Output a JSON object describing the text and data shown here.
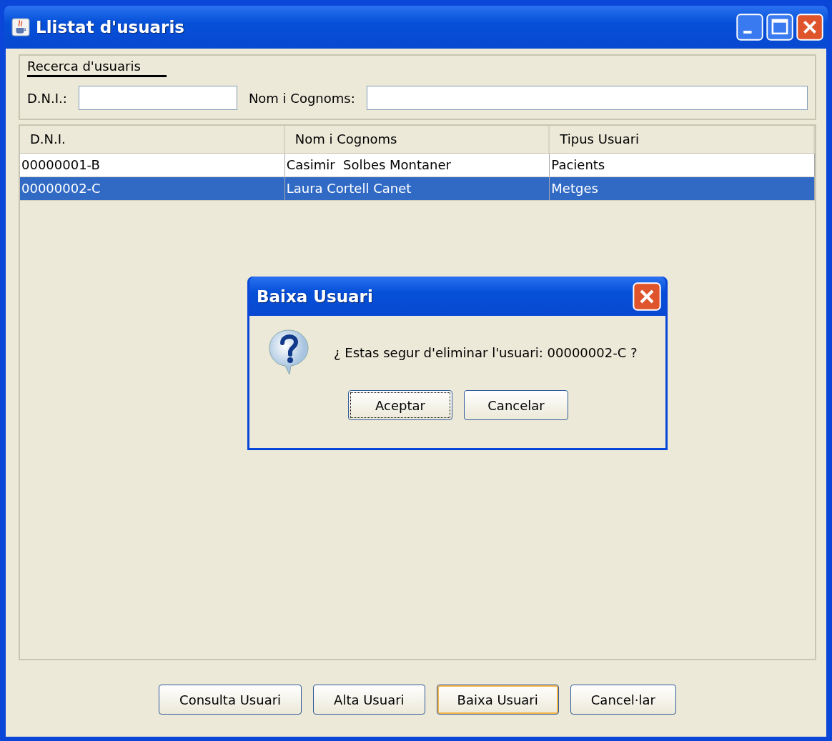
{
  "window": {
    "title": "Llistat d'usuaris"
  },
  "search": {
    "title": "Recerca d'usuaris",
    "fields": [
      {
        "label": "D.N.I.:"
      },
      {
        "label": "Nom i Cognoms:"
      }
    ]
  },
  "table": {
    "columns": [
      "D.N.I.",
      "Nom i Cognoms",
      "Tipus Usuari"
    ],
    "rows": [
      {
        "cells": [
          "00000001-B",
          "Casimir  Solbes Montaner",
          "Pacients"
        ],
        "selected": false
      },
      {
        "cells": [
          "00000002-C",
          "Laura Cortell Canet",
          "Metges"
        ],
        "selected": true
      }
    ]
  },
  "buttons": [
    {
      "label": "Consulta Usuari",
      "focused": false
    },
    {
      "label": "Alta Usuari",
      "focused": false
    },
    {
      "label": "Baixa Usuari",
      "focused": true
    },
    {
      "label": "Cancel·lar",
      "focused": false
    }
  ],
  "dialog": {
    "title": "Baixa Usuari",
    "message": "¿ Estas segur d'eliminar l'usuari: 00000002-C ?",
    "buttons": [
      {
        "label": "Aceptar",
        "focused": true
      },
      {
        "label": "Cancelar",
        "focused": false
      }
    ]
  }
}
